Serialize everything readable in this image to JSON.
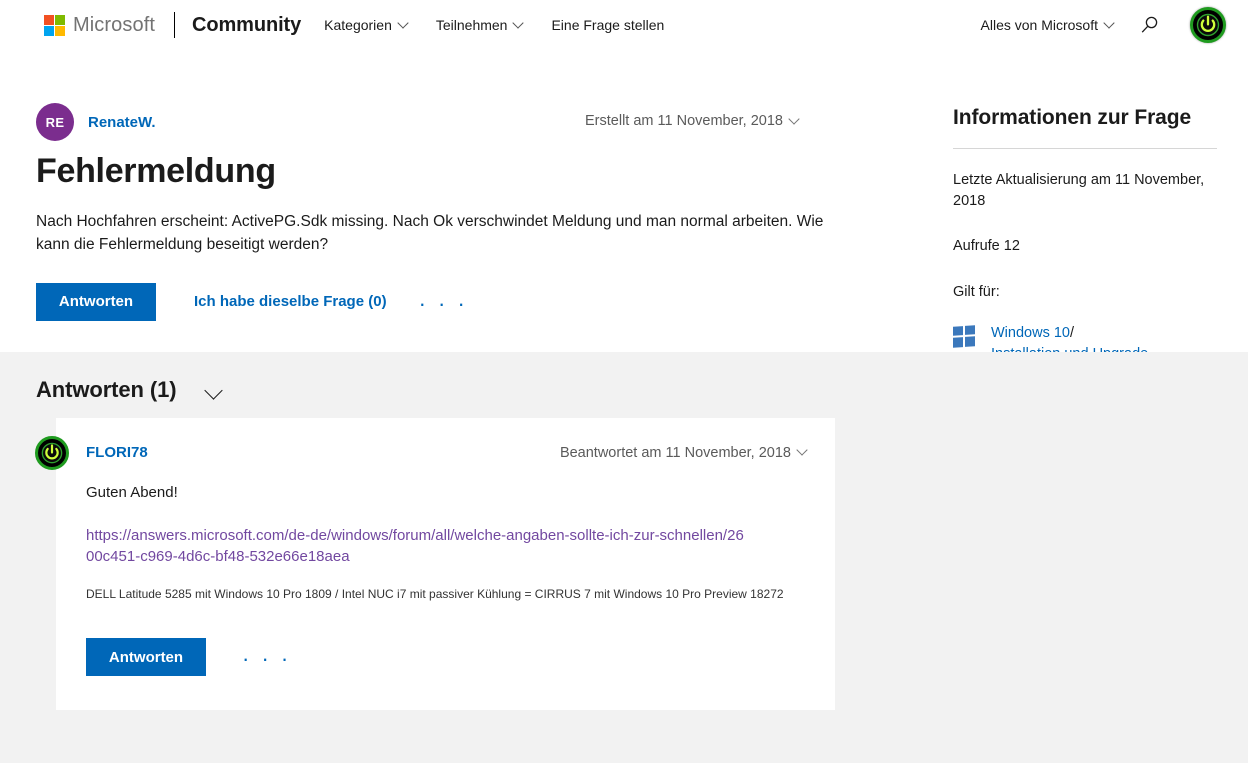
{
  "header": {
    "brand": "Microsoft",
    "product": "Community",
    "nav": [
      {
        "label": "Kategorien",
        "has_caret": true
      },
      {
        "label": "Teilnehmen",
        "has_caret": true
      },
      {
        "label": "Eine Frage stellen",
        "has_caret": false
      }
    ],
    "all_microsoft": "Alles von Microsoft",
    "search_icon": "search-icon",
    "avatar_icon": "power-button-icon"
  },
  "question": {
    "author_initials": "RE",
    "author_name": "RenateW.",
    "created_label": "Erstellt am 11 November, 2018",
    "title": "Fehlermeldung",
    "body": "Nach Hochfahren erscheint: ActivePG.Sdk missing. Nach Ok verschwindet Meldung und man normal arbeiten. Wie kann die Fehlermeldung beseitigt werden?",
    "reply_button": "Antworten",
    "same_question_link": "Ich habe dieselbe Frage (0)",
    "more_actions": "· · ·"
  },
  "sidebar": {
    "title": "Informationen zur Frage",
    "last_updated": "Letzte Aktualisierung am 11 November, 2018",
    "views": "Aufrufe 12",
    "applies_to_label": "Gilt für:",
    "applies_to_product": "Windows 10",
    "applies_to_separator": "/",
    "applies_to_category": "Installation und Upgrade",
    "product_icon": "windows-logo-icon"
  },
  "answers": {
    "heading": "Antworten (1)",
    "collapse_icon": "chevron-down-icon",
    "items": [
      {
        "author_name": "FLORI78",
        "avatar_icon": "power-button-icon",
        "answered_label": "Beantwortet am 11 November, 2018",
        "greeting": "Guten Abend!",
        "link_text": "https://answers.microsoft.com/de-de/windows/forum/all/welche-angaben-sollte-ich-zur-schnellen/2600c451-c969-4d6c-bf48-532e66e18aea",
        "signature": "DELL Latitude 5285 mit Windows 10 Pro 1809 / Intel NUC i7 mit passiver Kühlung = CIRRUS 7 mit Windows 10 Pro Preview 18272",
        "reply_button": "Antworten",
        "more_actions": "· · ·"
      }
    ]
  },
  "colors": {
    "accent_blue": "#0067b8",
    "link_visited_purple": "#7248a0",
    "avatar_purple": "#7b2d8e",
    "section_gray": "#f2f2f2",
    "windows_blue": "#3b78bc"
  }
}
